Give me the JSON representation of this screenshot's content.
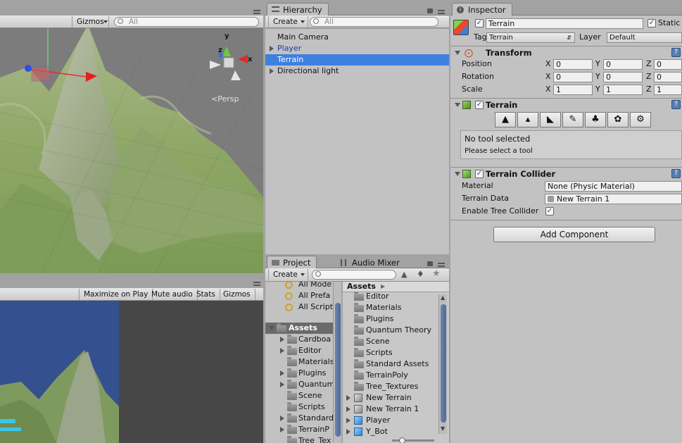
{
  "scene_view": {
    "gizmos_label": "Gizmos",
    "search_placeholder": "All",
    "persp_label": "Persp",
    "axis_x": "x",
    "axis_y": "y",
    "axis_z": "z"
  },
  "game_view": {
    "buttons": [
      "Maximize on Play",
      "Mute audio",
      "Stats",
      "Gizmos"
    ]
  },
  "hierarchy": {
    "tab_label": "Hierarchy",
    "create_label": "Create",
    "search_placeholder": "All",
    "items": [
      {
        "label": "Main Camera",
        "expandable": false,
        "selected": false,
        "color": "#111111"
      },
      {
        "label": "Player",
        "expandable": true,
        "selected": false,
        "color": "#1a3fa0"
      },
      {
        "label": "Terrain",
        "expandable": false,
        "selected": true,
        "color": "#ffffff"
      },
      {
        "label": "Directional light",
        "expandable": true,
        "selected": false,
        "color": "#111111"
      }
    ]
  },
  "project": {
    "tab_label": "Project",
    "audio_mixer_label": "Audio Mixer",
    "create_label": "Create",
    "favorites": [
      "All Mode",
      "All Prefa",
      "All Script"
    ],
    "assets_root": "Assets",
    "left_tree": [
      {
        "label": "Cardboa",
        "expandable": true
      },
      {
        "label": "Editor",
        "expandable": true
      },
      {
        "label": "Materials",
        "expandable": false
      },
      {
        "label": "Plugins",
        "expandable": true
      },
      {
        "label": "Quantum",
        "expandable": true
      },
      {
        "label": "Scene",
        "expandable": false
      },
      {
        "label": "Scripts",
        "expandable": false
      },
      {
        "label": "Standard",
        "expandable": true
      },
      {
        "label": "TerrainP",
        "expandable": true
      },
      {
        "label": "Tree_Tex",
        "expandable": false
      }
    ],
    "breadcrumb": "Assets",
    "right_list": [
      {
        "label": "Editor",
        "type": "folder",
        "expandable": false
      },
      {
        "label": "Materials",
        "type": "folder",
        "expandable": false
      },
      {
        "label": "Plugins",
        "type": "folder",
        "expandable": false
      },
      {
        "label": "Quantum Theory",
        "type": "folder",
        "expandable": false
      },
      {
        "label": "Scene",
        "type": "folder",
        "expandable": false
      },
      {
        "label": "Scripts",
        "type": "folder",
        "expandable": false
      },
      {
        "label": "Standard Assets",
        "type": "folder",
        "expandable": false
      },
      {
        "label": "TerrainPoly",
        "type": "folder",
        "expandable": false
      },
      {
        "label": "Tree_Textures",
        "type": "folder",
        "expandable": false
      },
      {
        "label": "New Terrain",
        "type": "asset",
        "expandable": true
      },
      {
        "label": "New Terrain 1",
        "type": "asset",
        "expandable": true
      },
      {
        "label": "Player",
        "type": "prefab",
        "expandable": true
      },
      {
        "label": "Y_Bot",
        "type": "prefab",
        "expandable": true
      }
    ]
  },
  "inspector": {
    "tab_label": "Inspector",
    "object_name": "Terrain",
    "static_label": "Static",
    "tag_label": "Tag",
    "tag_value": "Terrain",
    "layer_label": "Layer",
    "layer_value": "Default",
    "transform": {
      "title": "Transform",
      "rows": [
        {
          "label": "Position",
          "x": "0",
          "y": "0",
          "z": "0"
        },
        {
          "label": "Rotation",
          "x": "0",
          "y": "0",
          "z": "0"
        },
        {
          "label": "Scale",
          "x": "1",
          "y": "1",
          "z": "1"
        }
      ],
      "x_label": "X",
      "y_label": "Y",
      "z_label": "Z"
    },
    "terrain": {
      "title": "Terrain",
      "no_tool": "No tool selected",
      "please_select": "Please select a tool"
    },
    "collider": {
      "title": "Terrain Collider",
      "material_label": "Material",
      "material_value": "None (Physic Material)",
      "data_label": "Terrain Data",
      "data_value": "New Terrain 1",
      "tree_label": "Enable Tree Collider"
    },
    "add_component": "Add Component"
  }
}
